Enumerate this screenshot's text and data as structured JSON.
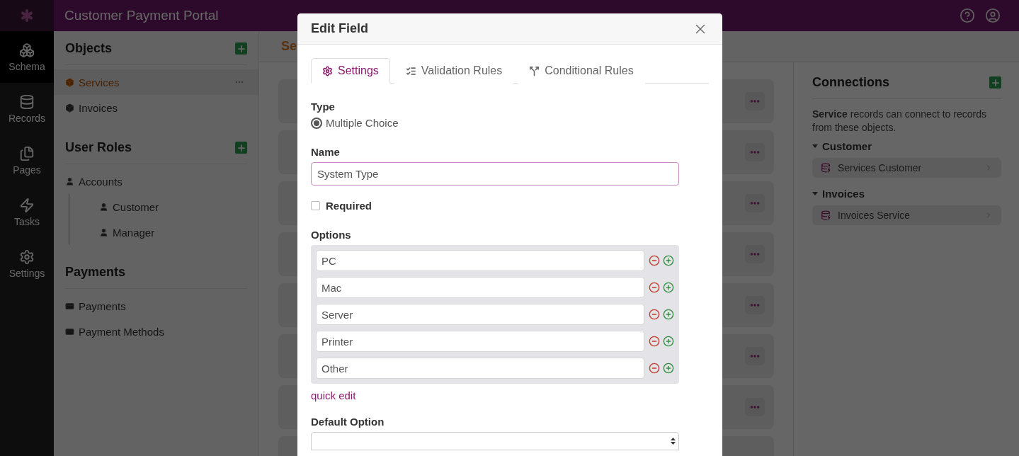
{
  "app": {
    "title": "Customer Payment Portal"
  },
  "nav": [
    {
      "kind": "schema",
      "label": "Schema",
      "selected": true
    },
    {
      "kind": "records",
      "label": "Records",
      "selected": false
    },
    {
      "kind": "pages",
      "label": "Pages",
      "selected": false
    },
    {
      "kind": "tasks",
      "label": "Tasks",
      "selected": false
    },
    {
      "kind": "settings",
      "label": "Settings",
      "selected": false
    }
  ],
  "sidebar": {
    "sections": [
      {
        "title": "Objects",
        "add": true,
        "items": [
          {
            "kind": "object",
            "label": "Services",
            "selected": true
          },
          {
            "kind": "object",
            "label": "Invoices",
            "selected": false
          }
        ]
      },
      {
        "title": "User Roles",
        "add": true,
        "items": [
          {
            "kind": "role",
            "label": "Accounts",
            "selected": false,
            "children": [
              {
                "kind": "role",
                "label": "Customer",
                "selected": false
              },
              {
                "kind": "role",
                "label": "Manager",
                "selected": false
              }
            ]
          }
        ]
      },
      {
        "title": "Payments",
        "add": false,
        "items": [
          {
            "kind": "payment",
            "label": "Payments",
            "selected": false
          },
          {
            "kind": "payment",
            "label": "Payment Methods",
            "selected": false
          }
        ]
      }
    ]
  },
  "main": {
    "header": "Se"
  },
  "connections": {
    "title": "Connections",
    "description": "**Service** records can connect to records from these objects.",
    "groups": [
      {
        "name": "Customer",
        "expanded": true,
        "items": [
          {
            "label": "Services Customer"
          }
        ]
      },
      {
        "name": "Invoices",
        "expanded": true,
        "items": [
          {
            "label": "Invoices Service"
          }
        ]
      }
    ]
  },
  "modal": {
    "title": "Edit Field",
    "tabs": [
      {
        "kind": "settings",
        "label": "Settings",
        "selected": true
      },
      {
        "kind": "validation",
        "label": "Validation Rules",
        "selected": false
      },
      {
        "kind": "conditional",
        "label": "Conditional Rules",
        "selected": false
      }
    ],
    "type": {
      "label": "Type",
      "option": "Multiple Choice",
      "selected": true
    },
    "name": {
      "label": "Name",
      "value": "System Type"
    },
    "required": {
      "label": "Required",
      "checked": false
    },
    "options": {
      "label": "Options",
      "values": [
        "PC",
        "Mac",
        "Server",
        "Printer",
        "Other"
      ]
    },
    "quick_edit": "quick edit",
    "default_option": {
      "label": "Default Option"
    }
  }
}
